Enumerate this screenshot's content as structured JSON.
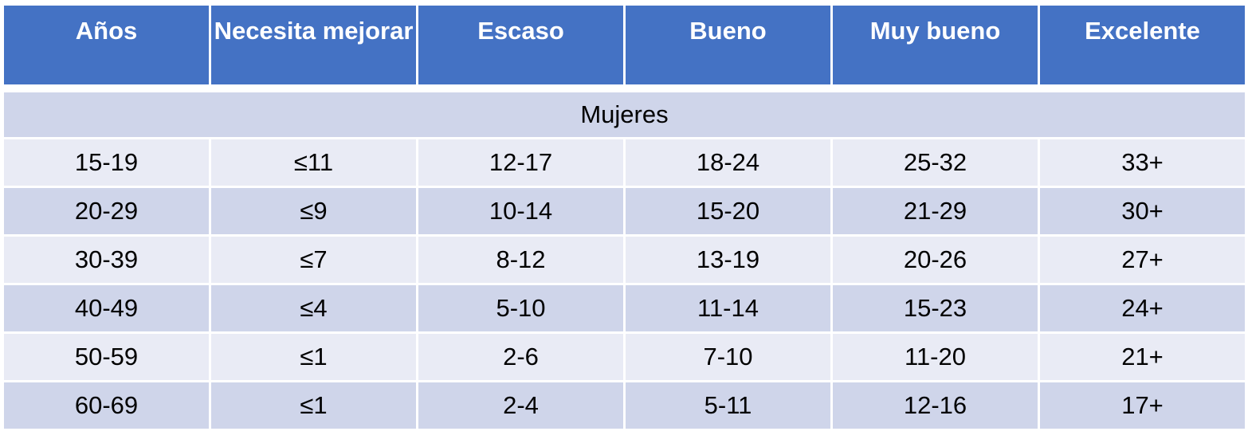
{
  "table": {
    "headers": [
      "Años",
      "Necesita mejorar",
      "Escaso",
      "Bueno",
      "Muy bueno",
      "Excelente"
    ],
    "section_label": "Mujeres",
    "rows": [
      [
        "15-19",
        "≤11",
        "12-17",
        "18-24",
        "25-32",
        "33+"
      ],
      [
        "20-29",
        "≤9",
        "10-14",
        "15-20",
        "21-29",
        "30+"
      ],
      [
        "30-39",
        "≤7",
        "8-12",
        "13-19",
        "20-26",
        "27+"
      ],
      [
        "40-49",
        "≤4",
        "5-10",
        "11-14",
        "15-23",
        "24+"
      ],
      [
        "50-59",
        "≤1",
        "2-6",
        "7-10",
        "11-20",
        "21+"
      ],
      [
        "60-69",
        "≤1",
        "2-4",
        "5-11",
        "12-16",
        "17+"
      ]
    ]
  },
  "colors": {
    "header_bg": "#4472c4",
    "band_dark": "#cfd5ea",
    "band_light": "#e9ebf5"
  }
}
